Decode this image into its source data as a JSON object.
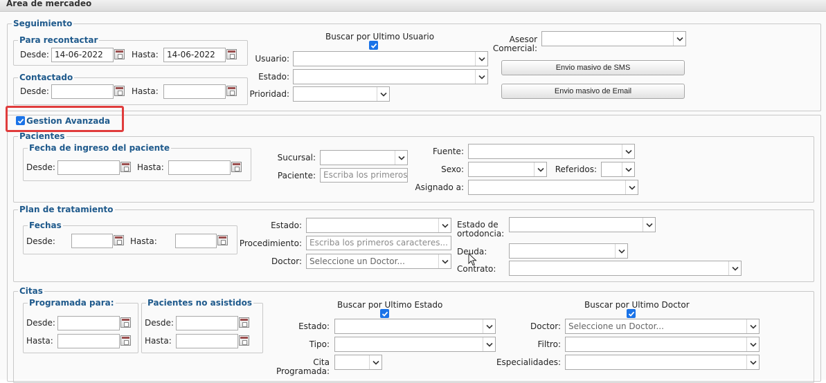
{
  "header": {
    "title": "Área de mercadeo"
  },
  "seguimiento": {
    "legend": "Seguimiento",
    "para_recontactar": {
      "legend": "Para recontactar",
      "desde_label": "Desde:",
      "desde_value": "14-06-2022",
      "hasta_label": "Hasta:",
      "hasta_value": "14-06-2022"
    },
    "contactado": {
      "legend": "Contactado",
      "desde_label": "Desde:",
      "desde_value": "",
      "hasta_label": "Hasta:",
      "hasta_value": ""
    },
    "buscar_ultimo_usuario_label": "Buscar por Ultimo Usuario",
    "buscar_ultimo_usuario_checked": true,
    "usuario_label": "Usuario:",
    "usuario_value": "",
    "estado_label": "Estado:",
    "estado_value": "",
    "prioridad_label": "Prioridad:",
    "prioridad_value": "",
    "asesor_label_line1": "Asesor",
    "asesor_label_line2": "Comercial:",
    "asesor_value": "",
    "sms_button": "Envio masivo de SMS",
    "email_button": "Envio masivo de Email"
  },
  "gestion": {
    "label": "Gestion Avanzada",
    "checked": true,
    "highlight_color": "#e03c3c",
    "pacientes": {
      "legend": "Pacientes",
      "fecha_ingreso": {
        "legend": "Fecha de ingreso del paciente",
        "desde_label": "Desde:",
        "desde_value": "",
        "hasta_label": "Hasta:",
        "hasta_value": ""
      },
      "sucursal_label": "Sucursal:",
      "sucursal_value": "",
      "paciente_label": "Paciente:",
      "paciente_placeholder": "Escriba los primeros ca",
      "fuente_label": "Fuente:",
      "fuente_value": "",
      "sexo_label": "Sexo:",
      "sexo_value": "",
      "referidos_label": "Referidos:",
      "referidos_value": "",
      "asignado_label": "Asignado a:",
      "asignado_value": ""
    },
    "plan": {
      "legend": "Plan de tratamiento",
      "fechas": {
        "legend": "Fechas",
        "desde_label": "Desde:",
        "desde_value": "",
        "hasta_label": "Hasta:",
        "hasta_value": ""
      },
      "estado_label": "Estado:",
      "estado_value": "",
      "procedimiento_label": "Procedimiento:",
      "procedimiento_placeholder": "Escriba los primeros caracteres...",
      "doctor_label": "Doctor:",
      "doctor_placeholder": "Seleccione un Doctor...",
      "estado_ortodoncia_line1": "Estado de",
      "estado_ortodoncia_line2": "ortodoncia:",
      "estado_ortodoncia_value": "",
      "deuda_label": "Deuda:",
      "deuda_value": "",
      "contrato_label": "Contrato:",
      "contrato_value": ""
    },
    "citas": {
      "legend": "Citas",
      "programada": {
        "legend": "Programada para:",
        "desde_label": "Desde:",
        "desde_value": "",
        "hasta_label": "Hasta:",
        "hasta_value": ""
      },
      "no_asistidos": {
        "legend": "Pacientes no asistidos",
        "desde_label": "Desde:",
        "desde_value": "",
        "hasta_label": "Hasta:",
        "hasta_value": ""
      },
      "buscar_ultimo_estado_label": "Buscar por Ultimo Estado",
      "buscar_ultimo_estado_checked": true,
      "buscar_ultimo_doctor_label": "Buscar por Ultimo Doctor",
      "buscar_ultimo_doctor_checked": true,
      "estado_label": "Estado:",
      "estado_value": "",
      "tipo_label": "Tipo:",
      "tipo_value": "",
      "cita_programada_line1": "Cita",
      "cita_programada_line2": "Programada:",
      "cita_programada_value": "",
      "doctor_label": "Doctor:",
      "doctor_placeholder": "Seleccione un Doctor...",
      "filtro_label": "Filtro:",
      "filtro_value": "",
      "especialidades_label": "Especialidades:",
      "especialidades_value": ""
    }
  }
}
